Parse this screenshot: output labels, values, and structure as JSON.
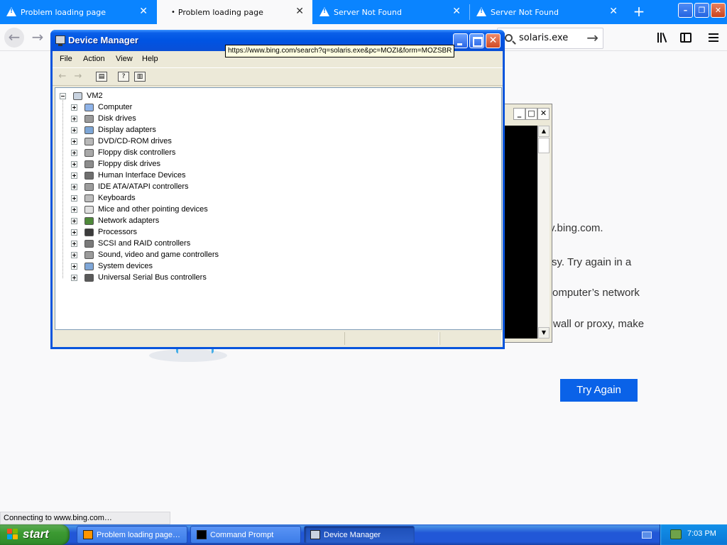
{
  "browser": {
    "tabs": [
      {
        "title": "Problem loading page",
        "active": false,
        "icon": "warning-icon",
        "close": "✕"
      },
      {
        "title": "Problem loading page",
        "active": true,
        "icon": "loading-dot",
        "close": "✕"
      },
      {
        "title": "Server Not Found",
        "active": false,
        "icon": "warning-icon",
        "close": "✕"
      },
      {
        "title": "Server Not Found",
        "active": false,
        "icon": "warning-icon",
        "close": "✕"
      }
    ],
    "new_tab": "+",
    "search": {
      "value": "solaris.exe"
    },
    "status_text": "Connecting to www.bing.com…",
    "accent": "#0a84ff"
  },
  "page": {
    "lines": [
      "v.bing.com.",
      "sy. Try again in a",
      "omputer’s network",
      "wall or proxy, make"
    ],
    "try_again": "Try Again",
    "button_color": "#0a62e8"
  },
  "tooltip": {
    "text": "https://www.bing.com/search?q=solaris.exe&pc=MOZI&form=MOZSBR"
  },
  "device_manager": {
    "title": "Device Manager",
    "menu": [
      "File",
      "Action",
      "View",
      "Help"
    ],
    "root": "VM2",
    "nodes": [
      {
        "label": "Computer",
        "icon": "computer-icon"
      },
      {
        "label": "Disk drives",
        "icon": "disk-drive-icon"
      },
      {
        "label": "Display adapters",
        "icon": "display-adapter-icon"
      },
      {
        "label": "DVD/CD-ROM drives",
        "icon": "cdrom-icon"
      },
      {
        "label": "Floppy disk controllers",
        "icon": "floppy-controller-icon"
      },
      {
        "label": "Floppy disk drives",
        "icon": "floppy-drive-icon"
      },
      {
        "label": "Human Interface Devices",
        "icon": "hid-icon"
      },
      {
        "label": "IDE ATA/ATAPI controllers",
        "icon": "ide-controller-icon"
      },
      {
        "label": "Keyboards",
        "icon": "keyboard-icon"
      },
      {
        "label": "Mice and other pointing devices",
        "icon": "mouse-icon"
      },
      {
        "label": "Network adapters",
        "icon": "network-adapter-icon"
      },
      {
        "label": "Processors",
        "icon": "processor-icon"
      },
      {
        "label": "SCSI and RAID controllers",
        "icon": "scsi-icon"
      },
      {
        "label": "Sound, video and game controllers",
        "icon": "sound-icon"
      },
      {
        "label": "System devices",
        "icon": "system-device-icon"
      },
      {
        "label": "Universal Serial Bus controllers",
        "icon": "usb-icon"
      }
    ]
  },
  "taskbar": {
    "start": "start",
    "buttons": [
      {
        "label": "Problem loading page…",
        "active": false
      },
      {
        "label": "Command Prompt",
        "active": false
      },
      {
        "label": "Device Manager",
        "active": true
      }
    ],
    "clock": "7:03 PM"
  }
}
